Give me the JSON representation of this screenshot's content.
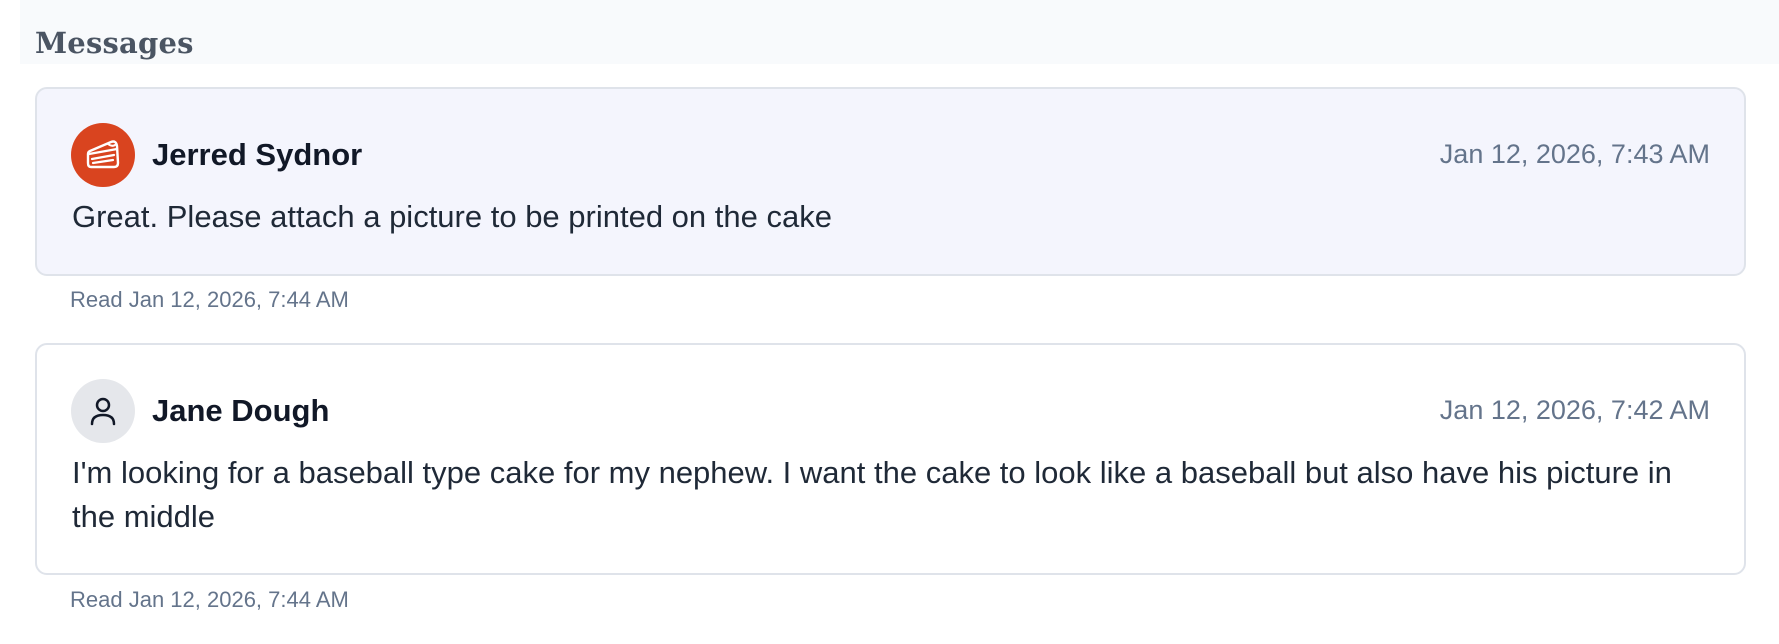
{
  "section": {
    "title": "Messages"
  },
  "messages": [
    {
      "author": "Jerred Sydnor",
      "timestamp": "Jan 12, 2026, 7:43 AM",
      "text": "Great. Please attach a picture to be printed on the cake",
      "read_receipt": "Read Jan 12, 2026, 7:44 AM",
      "avatar_icon": "cake-icon",
      "avatar_color": "#d9441f",
      "card_color": "#f4f5fd"
    },
    {
      "author": "Jane Dough",
      "timestamp": "Jan 12, 2026, 7:42 AM",
      "text": "I'm looking for a baseball type cake for my nephew. I want the cake to look like a baseball but also have his picture in the middle",
      "read_receipt": "Read Jan 12, 2026, 7:44 AM",
      "avatar_icon": "user-icon",
      "avatar_color": "#e5e7eb",
      "card_color": "#ffffff"
    }
  ]
}
